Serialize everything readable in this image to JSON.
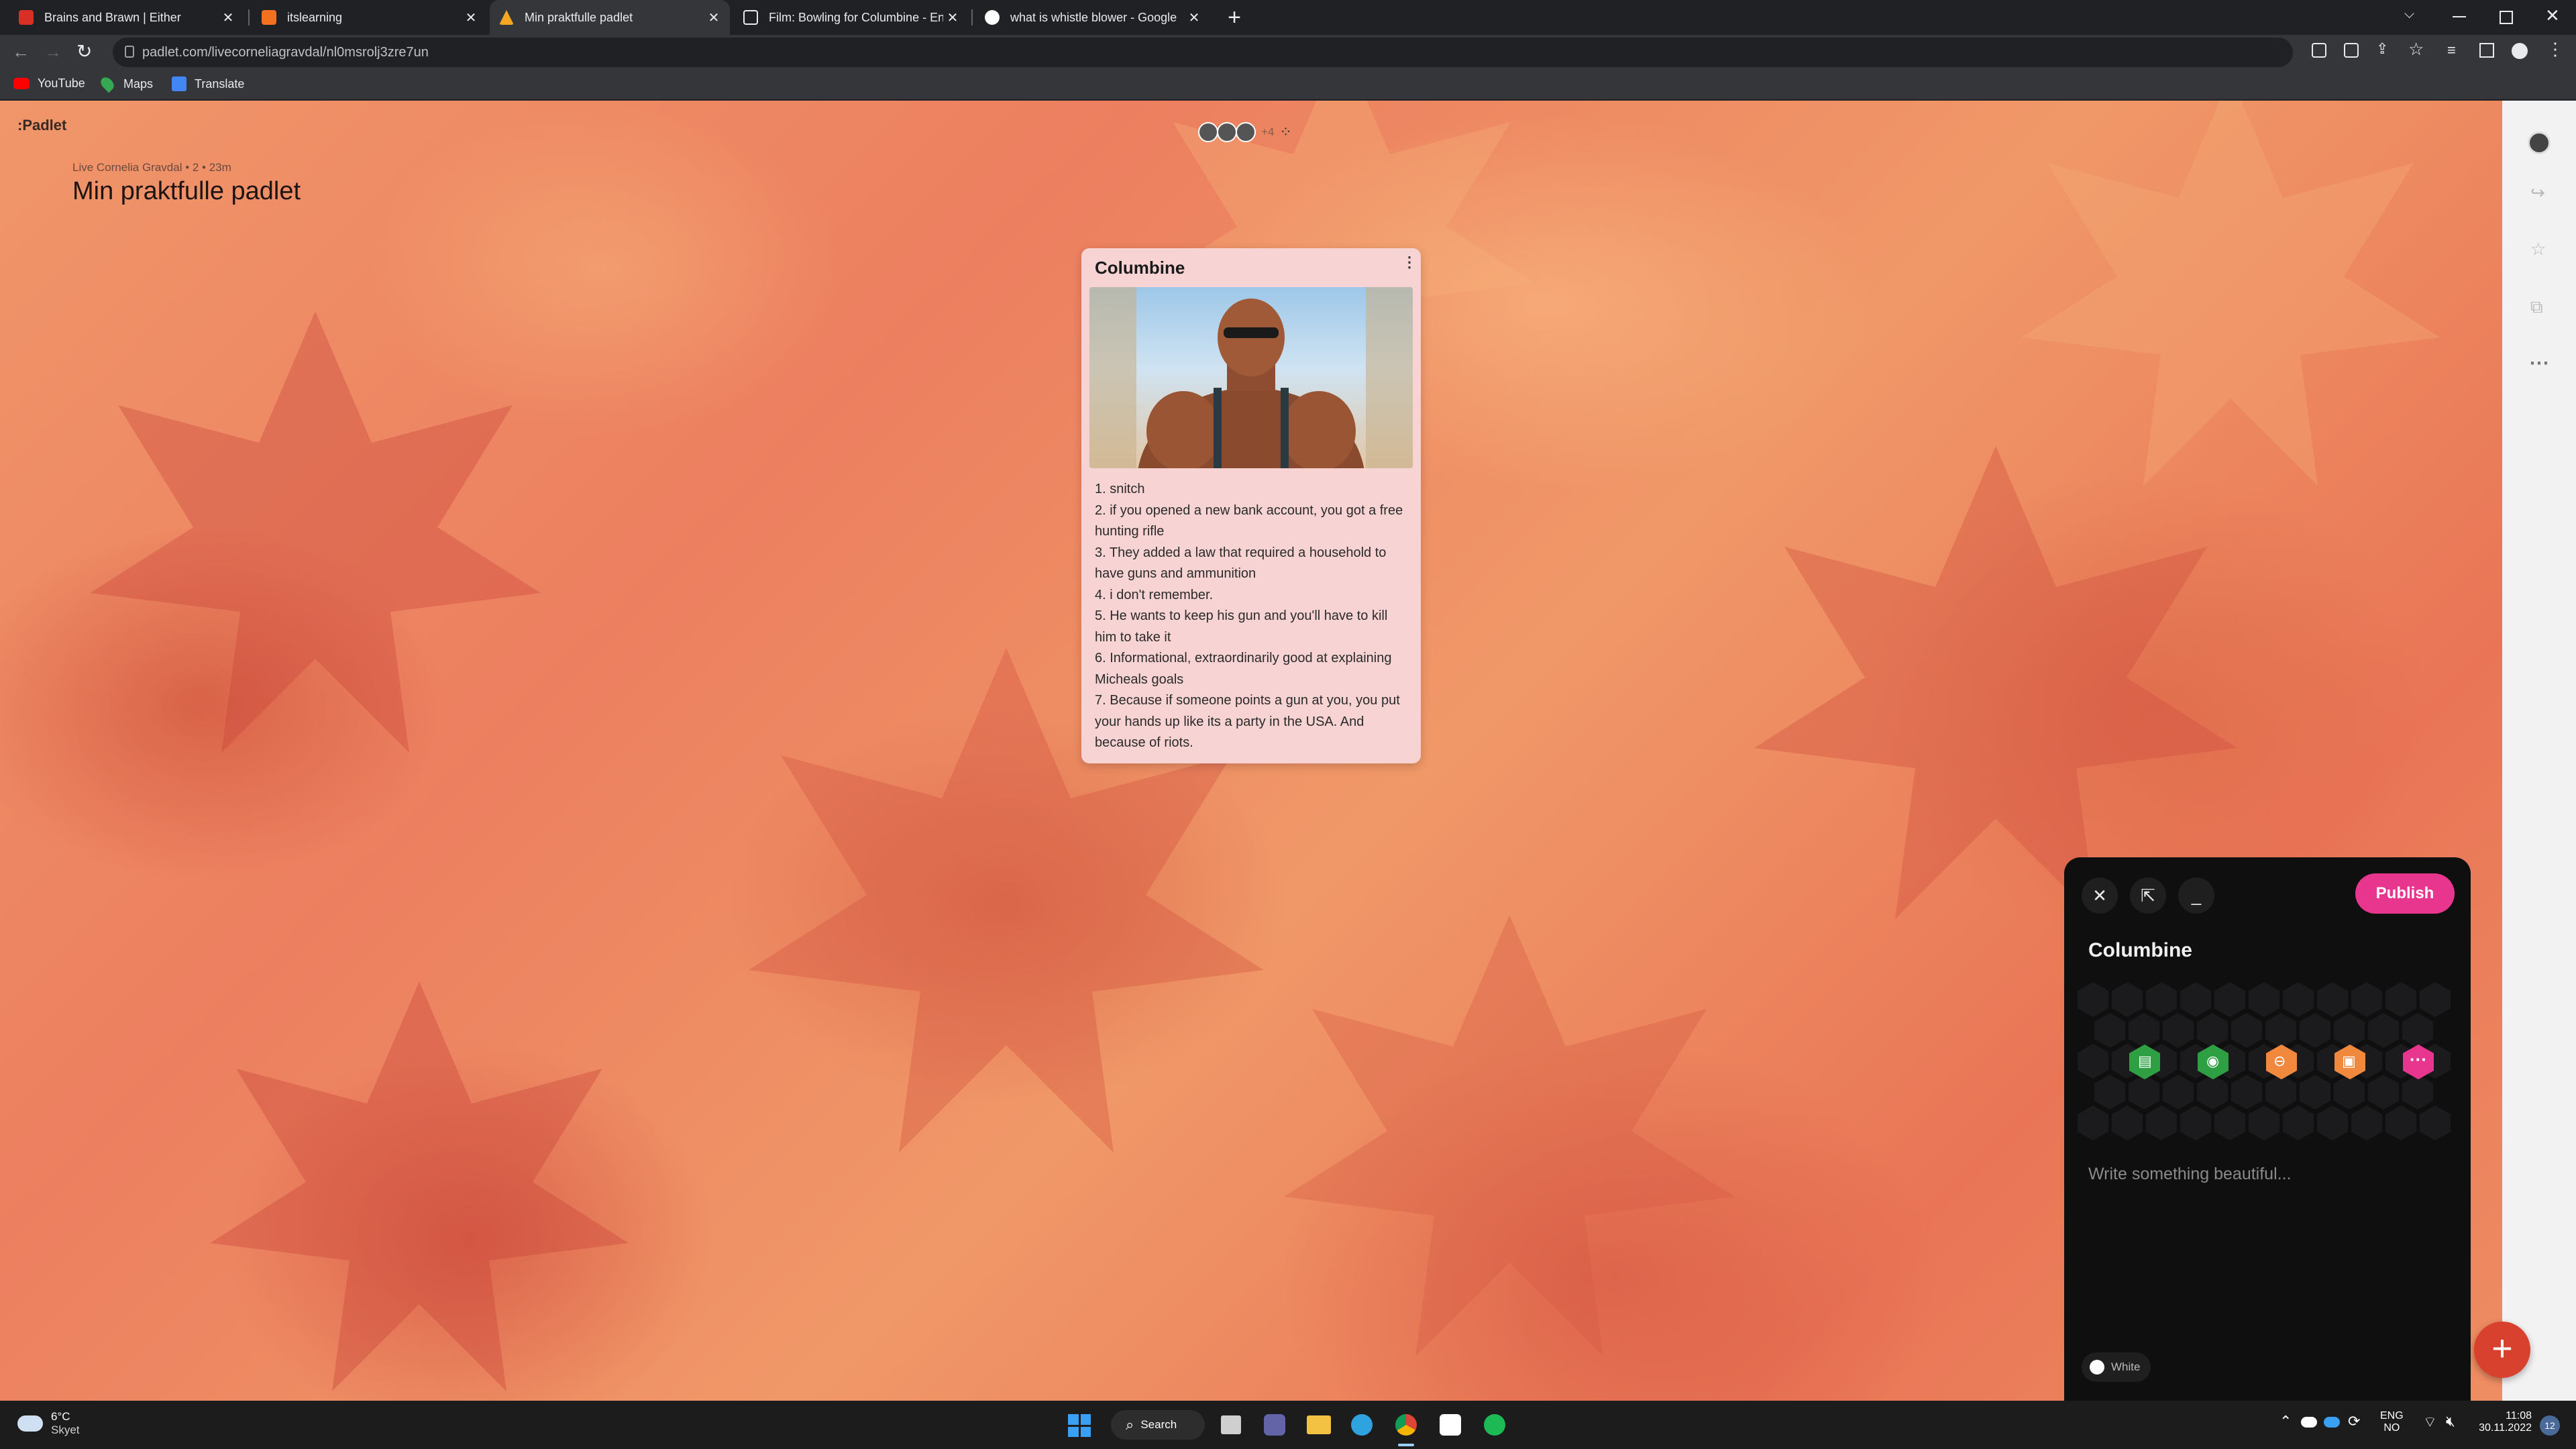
{
  "browser": {
    "tabs": [
      {
        "title": "Brains and Brawn | Either",
        "favicon": "either-icon",
        "color": "#d93025",
        "active": false
      },
      {
        "title": "itslearning",
        "favicon": "itslearning-icon",
        "color": "#f37021",
        "active": false
      },
      {
        "title": "Min praktfulle padlet",
        "favicon": "padlet-icon",
        "color": "#f5a623",
        "active": true
      },
      {
        "title": "Film: Bowling for Columbine - En",
        "favicon": "page-icon",
        "color": "#e8eaed",
        "active": false
      },
      {
        "title": "what is whistle blower - Google",
        "favicon": "google-icon",
        "color": "#e8eaed",
        "active": false
      }
    ],
    "url": "padlet.com/livecorneliagravdal/nl0msrolj3zre7un",
    "bookmarks": [
      {
        "label": "YouTube",
        "icon": "youtube-icon",
        "color": "#ff0000"
      },
      {
        "label": "Maps",
        "icon": "maps-icon",
        "color": "#34a853"
      },
      {
        "label": "Translate",
        "icon": "translate-icon",
        "color": "#4285f4"
      }
    ]
  },
  "padlet": {
    "logo": "Padlet",
    "meta": "Live Cornelia Gravdal • 2 • 23m",
    "title": "Min praktfulle padlet",
    "collaborators_more": "+4"
  },
  "post": {
    "title": "Columbine",
    "lines": [
      "1. snitch",
      "2. if you opened a new bank account, you got a free hunting rifle",
      "3. They added a law that required a household to have guns and ammunition",
      "4. i don't remember.",
      "5. He wants to keep his gun and you'll have to kill him to take it",
      "6. Informational, extraordinarily good at explaining Micheals goals",
      "7. Because if someone points a gun at you, you put your hands up like its a party in the USA. And because of riots."
    ]
  },
  "composer": {
    "publish_label": "Publish",
    "title": "Columbine",
    "body_placeholder": "Write something beautiful...",
    "color_label": "White",
    "attachments": [
      {
        "icon": "upload-file-icon",
        "color": "#2ea043"
      },
      {
        "icon": "camera-icon",
        "color": "#2ea043"
      },
      {
        "icon": "link-icon",
        "color": "#f0883e"
      },
      {
        "icon": "image-search-icon",
        "color": "#f0883e"
      },
      {
        "icon": "more-icon",
        "color": "#e8368f"
      }
    ]
  },
  "taskbar": {
    "weather_temp": "6°C",
    "weather_desc": "Skyet",
    "search_label": "Search",
    "lang_top": "ENG",
    "lang_bottom": "NO",
    "time": "11:08",
    "date": "30.11.2022",
    "notification_count": "12"
  }
}
